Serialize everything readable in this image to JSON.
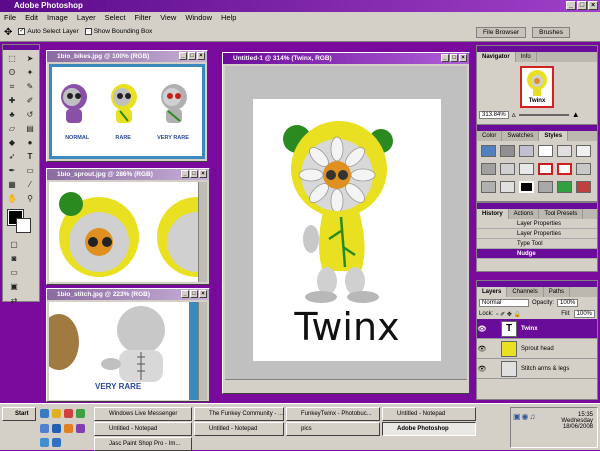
{
  "app": {
    "title": "Adobe Photoshop",
    "menus": [
      "File",
      "Edit",
      "Image",
      "Layer",
      "Select",
      "Filter",
      "View",
      "Window",
      "Help"
    ]
  },
  "options": {
    "auto_select": "Auto Select Layer",
    "bounding": "Show Bounding Box",
    "file_browser": "File Browser",
    "brushes": "Brushes"
  },
  "docs": {
    "bikes": {
      "title": "1bio_bikes.jpg @ 100% (RGB)",
      "labels": [
        "NORMAL",
        "RARE",
        "VERY RARE"
      ]
    },
    "sprout": {
      "title": "1bio_sprout.jpg @ 286% (RGB)"
    },
    "stitch": {
      "title": "1bio_stitch.jpg @ 223% (RGB)",
      "label": "VERY RARE"
    },
    "main": {
      "title": "Untitled-1 @ 314% (Twinx, RGB)",
      "text": "Twinx"
    }
  },
  "navigator": {
    "tabs": [
      "Navigator",
      "Info"
    ],
    "zoom": "313.84%",
    "thumb_text": "Twinx"
  },
  "styles": {
    "tabs": [
      "Color",
      "Swatches",
      "Styles"
    ]
  },
  "history": {
    "tabs": [
      "History",
      "Actions",
      "Tool Presets"
    ],
    "items": [
      "Layer Properties",
      "Layer Properties",
      "Type Tool",
      "Nudge"
    ]
  },
  "layers": {
    "tabs": [
      "Layers",
      "Channels",
      "Paths"
    ],
    "blend": "Normal",
    "opacity_label": "Opacity:",
    "opacity": "100%",
    "lock_label": "Lock:",
    "fill_label": "Fill:",
    "fill": "100%",
    "items": [
      {
        "name": "Twinx",
        "thumb": "T"
      },
      {
        "name": "Sprout head",
        "thumb": ""
      },
      {
        "name": "Stitch arms & legs",
        "thumb": ""
      }
    ]
  },
  "taskbar": {
    "start": "Start",
    "items": [
      "Windows Live Messenger",
      "The Funkey Community - ...",
      "FunkeyTwinx - Photobuc...",
      "Untitled - Notepad",
      "Untitled - Notepad",
      "Untitled - Notepad",
      "pics",
      "Adobe Photoshop",
      "Jasc Paint Shop Pro - Im..."
    ],
    "time": "15:35",
    "day": "Wednesday",
    "date": "18/06/2008"
  },
  "colors": {
    "accent": "#7a0a9c",
    "title_active": "#6a0c9a",
    "yellow": "#e8e020",
    "green": "#2a8a20"
  }
}
